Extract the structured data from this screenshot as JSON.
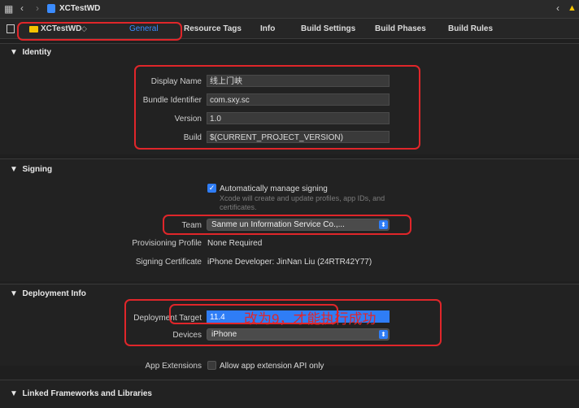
{
  "toolbar": {
    "project_title": "XCTestWD",
    "warning_symbol": "▲"
  },
  "tabs": {
    "target": "XCTestWD",
    "items": [
      "General",
      "Resource Tags",
      "Info",
      "Build Settings",
      "Build Phases",
      "Build Rules"
    ],
    "active": "General"
  },
  "identity": {
    "header": "Identity",
    "display_name_label": "Display Name",
    "display_name": "线上门峡",
    "bundle_id_label": "Bundle Identifier",
    "bundle_id": "com.sxy.sc",
    "version_label": "Version",
    "version": "1.0",
    "build_label": "Build",
    "build": "$(CURRENT_PROJECT_VERSION)"
  },
  "signing": {
    "header": "Signing",
    "auto_label": "Automatically manage signing",
    "auto_note": "Xcode will create and update profiles, app IDs, and certificates.",
    "team_label": "Team",
    "team": "Sanme       un Information Service Co.,...",
    "profile_label": "Provisioning Profile",
    "profile": "None Required",
    "cert_label": "Signing Certificate",
    "cert": "iPhone Developer: JinNan Liu (24RTR42Y77)"
  },
  "deployment": {
    "header": "Deployment Info",
    "target_label": "Deployment Target",
    "target": "11.4",
    "devices_label": "Devices",
    "devices": "iPhone",
    "annotation": "改为9，才能执行成功",
    "app_ext_label": "App Extensions",
    "app_ext_option": "Allow app extension API only"
  },
  "linked": {
    "header": "Linked Frameworks and Libraries"
  },
  "colors": {
    "accent": "#3b8cff",
    "annotation_red": "#e0262a",
    "background": "#1f1f1f"
  }
}
